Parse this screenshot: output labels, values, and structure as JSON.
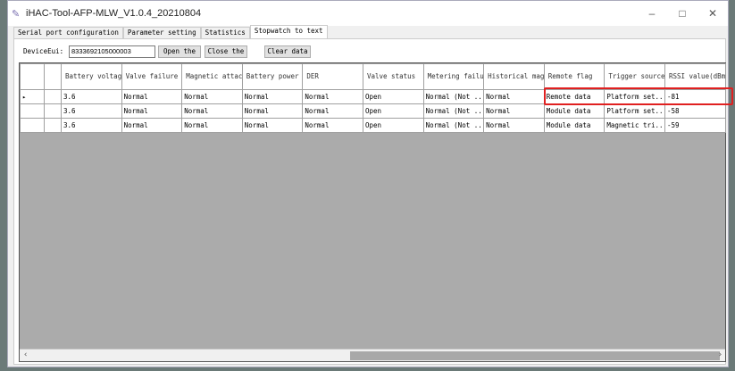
{
  "window": {
    "title": "iHAC-Tool-AFP-MLW_V1.0.4_20210804",
    "minimize": "–",
    "maximize": "□",
    "close": "✕"
  },
  "tabs": [
    {
      "label": "Serial port configuration"
    },
    {
      "label": "Parameter setting"
    },
    {
      "label": "Statistics"
    },
    {
      "label": "Stopwatch to text"
    }
  ],
  "toolbar": {
    "device_label": "DeviceEui:",
    "device_value": "8333692105000003",
    "open": "Open the",
    "close": "Close the",
    "clear": "Clear data"
  },
  "columns": [
    "Battery voltage(V)",
    "Valve failure",
    "Magnetic attack",
    "Battery power",
    "DER",
    "Valve status",
    "Metering failure",
    "Historical magnetic attack",
    "Remote flag",
    "Trigger source",
    "RSSI value(dBm)"
  ],
  "rows": [
    [
      "3.6",
      "Normal",
      "Normal",
      "Normal",
      "Normal",
      "Open",
      "Normal (Not ...",
      "Normal",
      "Remote data",
      "Platform set...",
      "-81"
    ],
    [
      "3.6",
      "Normal",
      "Normal",
      "Normal",
      "Normal",
      "Open",
      "Normal (Not ...",
      "Normal",
      "Module data",
      "Platform set...",
      "-58"
    ],
    [
      "3.6",
      "Normal",
      "Normal",
      "Normal",
      "Normal",
      "Open",
      "Normal (Not ...",
      "Normal",
      "Module data",
      "Magnetic tri...",
      "-59"
    ]
  ],
  "highlight_color": "#e02020"
}
